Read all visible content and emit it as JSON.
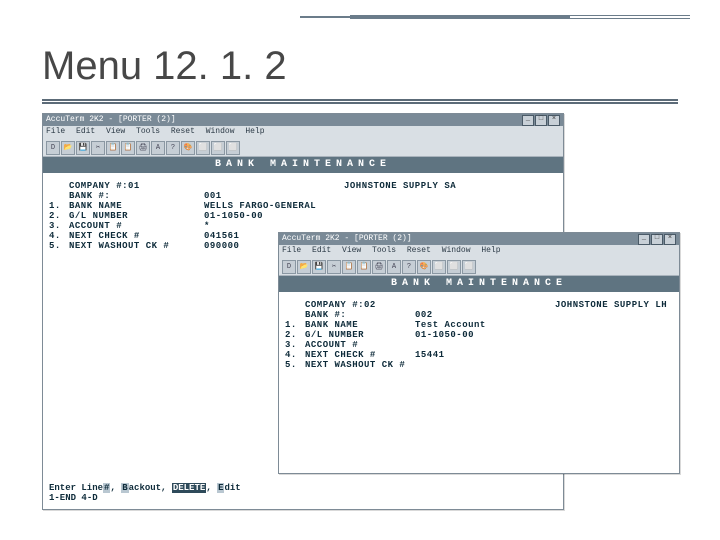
{
  "slide": {
    "title": "Menu 12. 1. 2"
  },
  "app": {
    "titlebar_caption": "AccuTerm 2K2 - [PORTER (2)]",
    "menus": [
      "File",
      "Edit",
      "View",
      "Tools",
      "Reset",
      "Window",
      "Help"
    ],
    "toolbar_icons": [
      "D",
      "📂",
      "💾",
      "✂",
      "📋",
      "📋",
      "🖨",
      "A",
      "?",
      "🎨",
      "⬜",
      "⬜",
      "⬜"
    ],
    "screen_title": "BANK MAINTENANCE"
  },
  "win1": {
    "company_label": "COMPANY #:",
    "company_no": "01",
    "company_name": "JOHNSTONE SUPPLY SA",
    "bank_no_label": "BANK #:",
    "bank_no": "001",
    "fields": [
      {
        "n": "1.",
        "label": "BANK NAME",
        "value": "WELLS FARGO-GENERAL"
      },
      {
        "n": "2.",
        "label": "G/L NUMBER",
        "value": "01-1050-00"
      },
      {
        "n": "3.",
        "label": "ACCOUNT #",
        "value": "*"
      },
      {
        "n": "4.",
        "label": "NEXT CHECK #",
        "value": "041561"
      },
      {
        "n": "5.",
        "label": "NEXT WASHOUT CK #",
        "value": "090000"
      }
    ],
    "footer": {
      "prefix": "Enter Line",
      "hl1": "#",
      "seg1": ", ",
      "hl2": "B",
      "seg2": "ackout, ",
      "hl_del": "DELETE",
      "seg3": ", ",
      "hl4": "E",
      "seg4": "dit",
      "line2a": "1-END",
      "line2b": "4-D"
    }
  },
  "win2": {
    "company_label": "COMPANY #:",
    "company_no": "02",
    "company_name": "JOHNSTONE SUPPLY LH",
    "bank_no_label": "BANK #:",
    "bank_no": "002",
    "fields": [
      {
        "n": "1.",
        "label": "BANK NAME",
        "value": "Test Account"
      },
      {
        "n": "2.",
        "label": "G/L NUMBER",
        "value": "01-1050-00"
      },
      {
        "n": "3.",
        "label": "ACCOUNT #",
        "value": ""
      },
      {
        "n": "4.",
        "label": "NEXT CHECK #",
        "value": "15441"
      },
      {
        "n": "5.",
        "label": "NEXT WASHOUT CK #",
        "value": ""
      }
    ]
  }
}
